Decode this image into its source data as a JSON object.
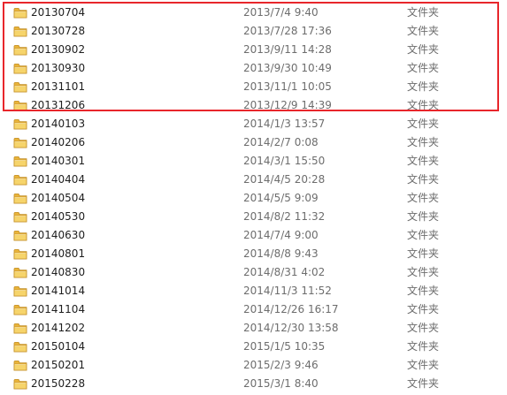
{
  "colors": {
    "highlight_border": "#e8262b",
    "folder_icon": "#f2c24c",
    "secondary_text": "#6d6d6d"
  },
  "icon": "folder-icon",
  "files": [
    {
      "name": "20130704",
      "date": "2013/7/4 9:40",
      "type": "文件夹"
    },
    {
      "name": "20130728",
      "date": "2013/7/28 17:36",
      "type": "文件夹"
    },
    {
      "name": "20130902",
      "date": "2013/9/11 14:28",
      "type": "文件夹"
    },
    {
      "name": "20130930",
      "date": "2013/9/30 10:49",
      "type": "文件夹"
    },
    {
      "name": "20131101",
      "date": "2013/11/1 10:05",
      "type": "文件夹"
    },
    {
      "name": "20131206",
      "date": "2013/12/9 14:39",
      "type": "文件夹"
    },
    {
      "name": "20140103",
      "date": "2014/1/3 13:57",
      "type": "文件夹"
    },
    {
      "name": "20140206",
      "date": "2014/2/7 0:08",
      "type": "文件夹"
    },
    {
      "name": "20140301",
      "date": "2014/3/1 15:50",
      "type": "文件夹"
    },
    {
      "name": "20140404",
      "date": "2014/4/5 20:28",
      "type": "文件夹"
    },
    {
      "name": "20140504",
      "date": "2014/5/5 9:09",
      "type": "文件夹"
    },
    {
      "name": "20140530",
      "date": "2014/8/2 11:32",
      "type": "文件夹"
    },
    {
      "name": "20140630",
      "date": "2014/7/4 9:00",
      "type": "文件夹"
    },
    {
      "name": "20140801",
      "date": "2014/8/8 9:43",
      "type": "文件夹"
    },
    {
      "name": "20140830",
      "date": "2014/8/31 4:02",
      "type": "文件夹"
    },
    {
      "name": "20141014",
      "date": "2014/11/3 11:52",
      "type": "文件夹"
    },
    {
      "name": "20141104",
      "date": "2014/12/26 16:17",
      "type": "文件夹"
    },
    {
      "name": "20141202",
      "date": "2014/12/30 13:58",
      "type": "文件夹"
    },
    {
      "name": "20150104",
      "date": "2015/1/5 10:35",
      "type": "文件夹"
    },
    {
      "name": "20150201",
      "date": "2015/2/3 9:46",
      "type": "文件夹"
    },
    {
      "name": "20150228",
      "date": "2015/3/1 8:40",
      "type": "文件夹"
    }
  ]
}
